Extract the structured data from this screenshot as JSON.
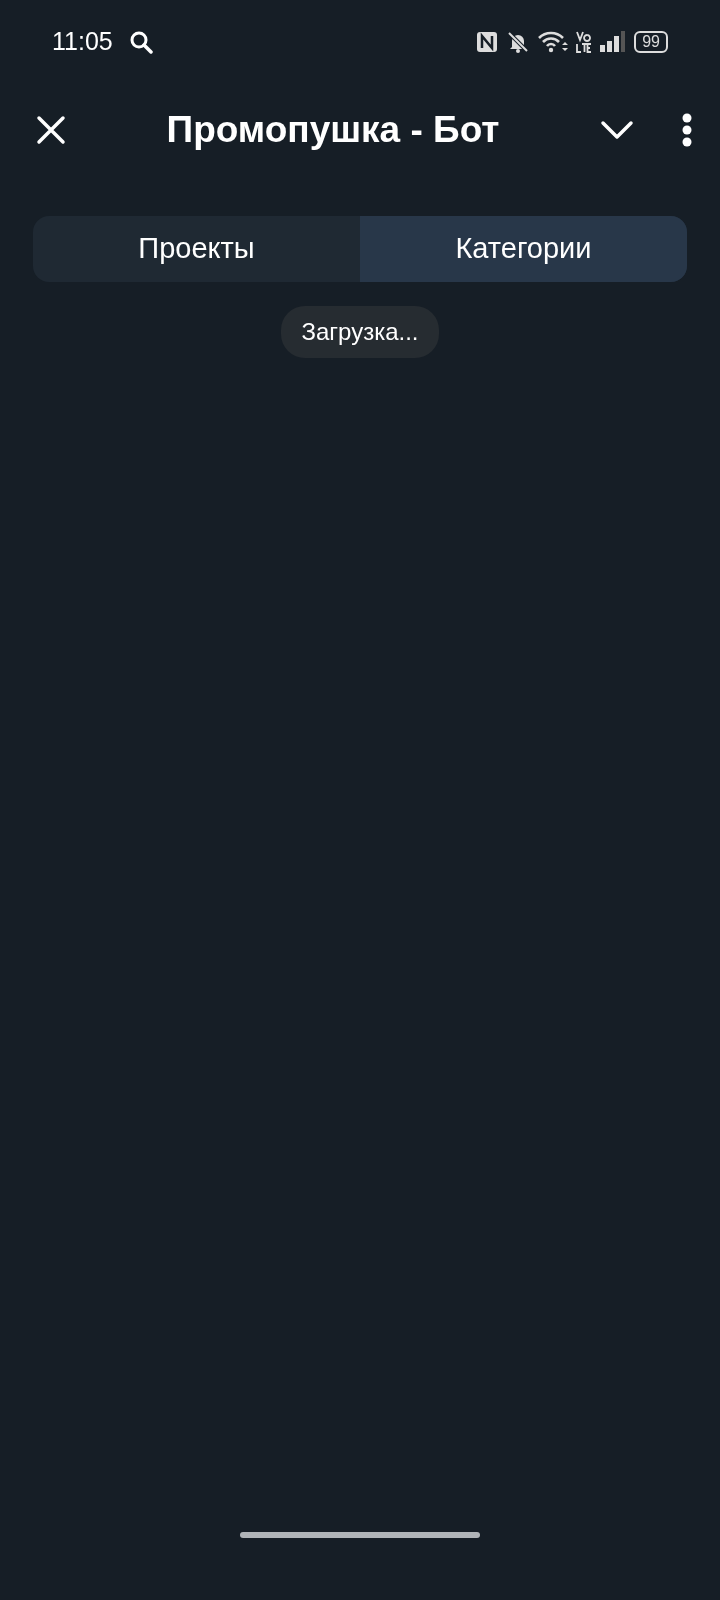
{
  "status_bar": {
    "time": "11:05",
    "battery": "99"
  },
  "header": {
    "title": "Промопушка - Бот"
  },
  "tabs": [
    {
      "label": "Проекты",
      "selected": false
    },
    {
      "label": "Категории",
      "selected": true
    }
  ],
  "loading": {
    "text": "Загрузка..."
  }
}
